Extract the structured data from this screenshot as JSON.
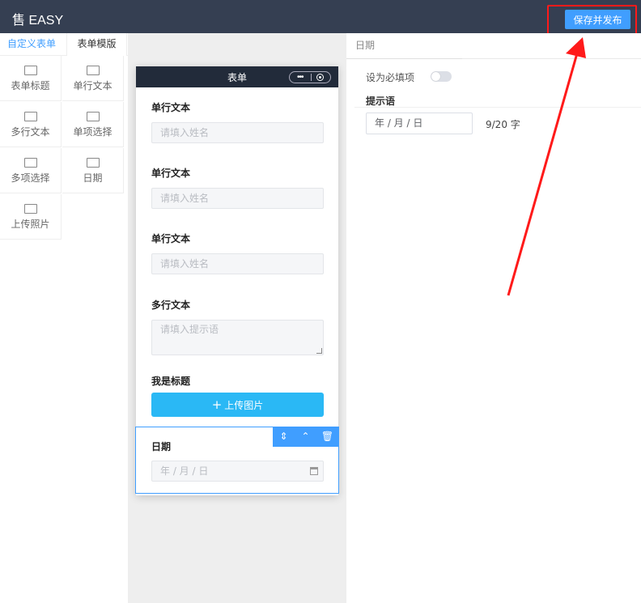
{
  "header": {
    "brand": "售 EASY",
    "save_label": "保存并发布"
  },
  "left_panel": {
    "tabs": [
      {
        "label": "自定义表单",
        "active": true
      },
      {
        "label": "表单模版",
        "active": false
      }
    ],
    "components": [
      {
        "label": "表单标题",
        "icon": "component-icon"
      },
      {
        "label": "单行文本",
        "icon": "component-icon"
      },
      {
        "label": "多行文本",
        "icon": "component-icon"
      },
      {
        "label": "单项选择",
        "icon": "component-icon"
      },
      {
        "label": "多项选择",
        "icon": "component-icon"
      },
      {
        "label": "日期",
        "icon": "component-icon"
      },
      {
        "label": "上传照片",
        "icon": "component-icon"
      }
    ]
  },
  "phone": {
    "title": "表单",
    "fields": [
      {
        "label": "单行文本",
        "placeholder": "请填入姓名"
      },
      {
        "label": "单行文本",
        "placeholder": "请填入姓名"
      },
      {
        "label": "单行文本",
        "placeholder": "请填入姓名"
      },
      {
        "label": "多行文本",
        "placeholder": "请填入提示语"
      }
    ],
    "upload": {
      "label": "我是标题",
      "button": "上传图片"
    },
    "date_field": {
      "label": "日期",
      "placeholder": "年 / 月 / 日"
    }
  },
  "right_panel": {
    "tab": "日期",
    "required_label": "设为必填项",
    "required_on": false,
    "hint_label": "提示语",
    "hint_value": "年 / 月 / 日",
    "hint_count": "9/20 字"
  },
  "colors": {
    "header_bg": "#353f52",
    "accent": "#409eff",
    "upload_btn": "#2ab8f5",
    "highlight": "#ff1a1a"
  }
}
